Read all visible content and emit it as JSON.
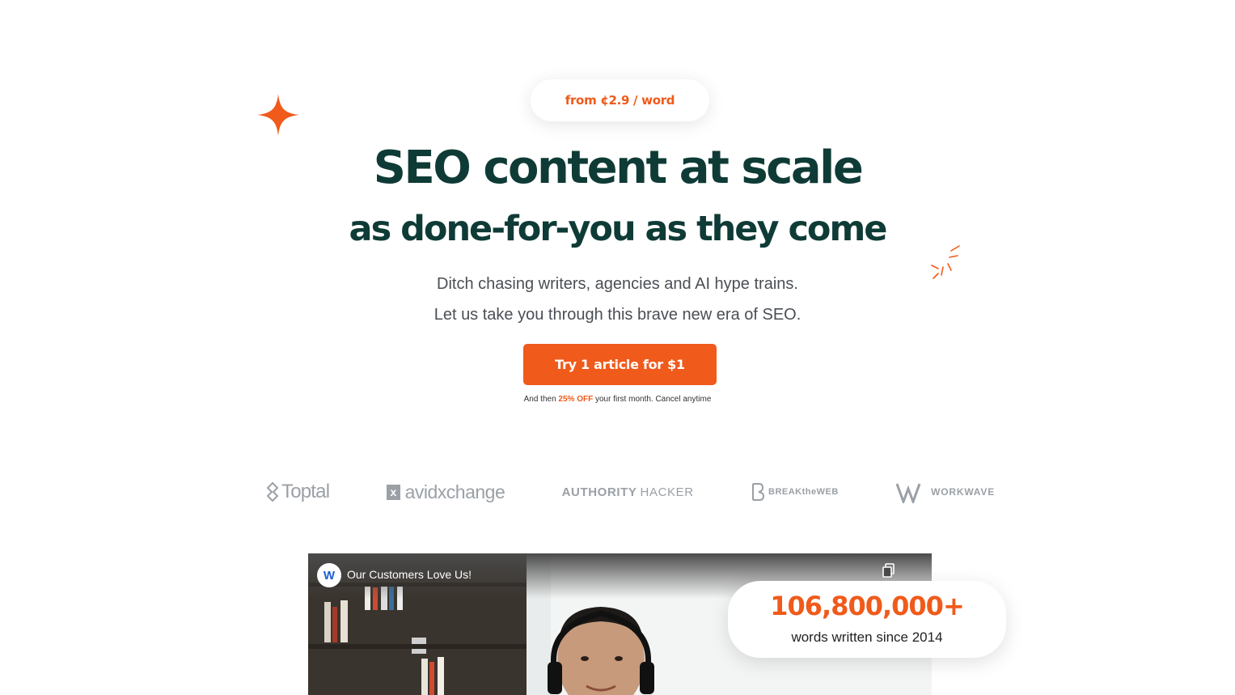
{
  "hero": {
    "price_pill": "from ¢2.9 / word",
    "headline_line1": "SEO content at scale",
    "headline_line2": "as done-for-you as they come",
    "subtext_line1": "Ditch chasing writers, agencies and AI hype trains.",
    "subtext_line2": "Let us take you through this brave new era of SEO.",
    "cta_label": "Try 1 article for $1",
    "cta_note_prefix": "And then ",
    "cta_note_highlight": "25% OFF",
    "cta_note_suffix": " your first month. Cancel anytime"
  },
  "logos": {
    "toptal": "Toptal",
    "avid_mark": "x",
    "avid": "avidxchange",
    "authority_bold": "AUTHORITY",
    "authority_light": "HACKER",
    "breaktheweb": "BREAKtheWEB",
    "workwave": "WORKWAVE"
  },
  "video": {
    "channel_initial": "W",
    "title": "Our Customers Love Us!"
  },
  "stat": {
    "number": "106,800,000+",
    "label": "words written since 2014"
  },
  "colors": {
    "accent": "#f05a1a",
    "heading": "#0f3b36",
    "logo_gray": "#9aa0a6"
  }
}
